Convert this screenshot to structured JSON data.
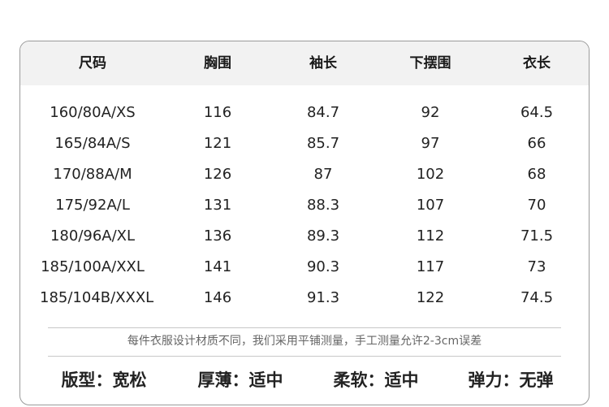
{
  "table": {
    "headers": [
      "尺码",
      "胸围",
      "袖长",
      "下摆围",
      "衣长"
    ],
    "rows": [
      [
        "160/80A/XS",
        "116",
        "84.7",
        "92",
        "64.5"
      ],
      [
        "165/84A/S",
        "121",
        "85.7",
        "97",
        "66"
      ],
      [
        "170/88A/M",
        "126",
        "87",
        "102",
        "68"
      ],
      [
        "175/92A/L",
        "131",
        "88.3",
        "107",
        "70"
      ],
      [
        "180/96A/XL",
        "136",
        "89.3",
        "112",
        "71.5"
      ],
      [
        "185/100A/XXL",
        "141",
        "90.3",
        "117",
        "73"
      ],
      [
        "185/104B/XXXL",
        "146",
        "91.3",
        "122",
        "74.5"
      ]
    ]
  },
  "note": "每件衣服设计材质不同，我们采用平铺测量，手工测量允许2-3cm误差",
  "properties": [
    {
      "label": "版型",
      "value": "宽松"
    },
    {
      "label": "厚薄",
      "value": "适中"
    },
    {
      "label": "柔软",
      "value": "适中"
    },
    {
      "label": "弹力",
      "value": "无弹"
    }
  ]
}
